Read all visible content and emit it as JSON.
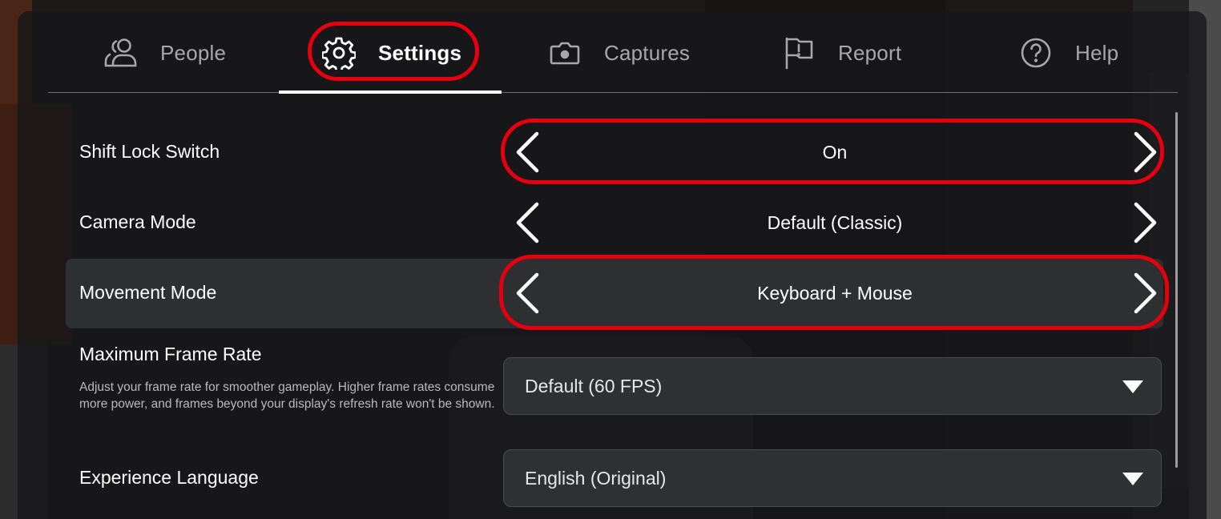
{
  "tabs": {
    "people": {
      "label": "People",
      "icon": "people-icon"
    },
    "settings": {
      "label": "Settings",
      "icon": "gear-icon"
    },
    "captures": {
      "label": "Captures",
      "icon": "camera-icon"
    },
    "report": {
      "label": "Report",
      "icon": "flag-icon"
    },
    "help": {
      "label": "Help",
      "icon": "help-icon"
    },
    "active": "Settings"
  },
  "settings": {
    "shift_lock": {
      "label": "Shift Lock Switch",
      "value": "On"
    },
    "camera_mode": {
      "label": "Camera Mode",
      "value": "Default (Classic)"
    },
    "movement_mode": {
      "label": "Movement Mode",
      "value": "Keyboard + Mouse"
    },
    "frame_rate": {
      "label": "Maximum Frame Rate",
      "description": "Adjust your frame rate for smoother gameplay. Higher frame rates consume more power, and frames beyond your display's refresh rate won't be shown.",
      "value": "Default (60 FPS)"
    },
    "experience_language": {
      "label": "Experience Language",
      "value": "English (Original)"
    }
  },
  "colors": {
    "highlight": "#e4000f",
    "text_active": "#ffffff",
    "text_inactive": "#a7a8aa"
  }
}
